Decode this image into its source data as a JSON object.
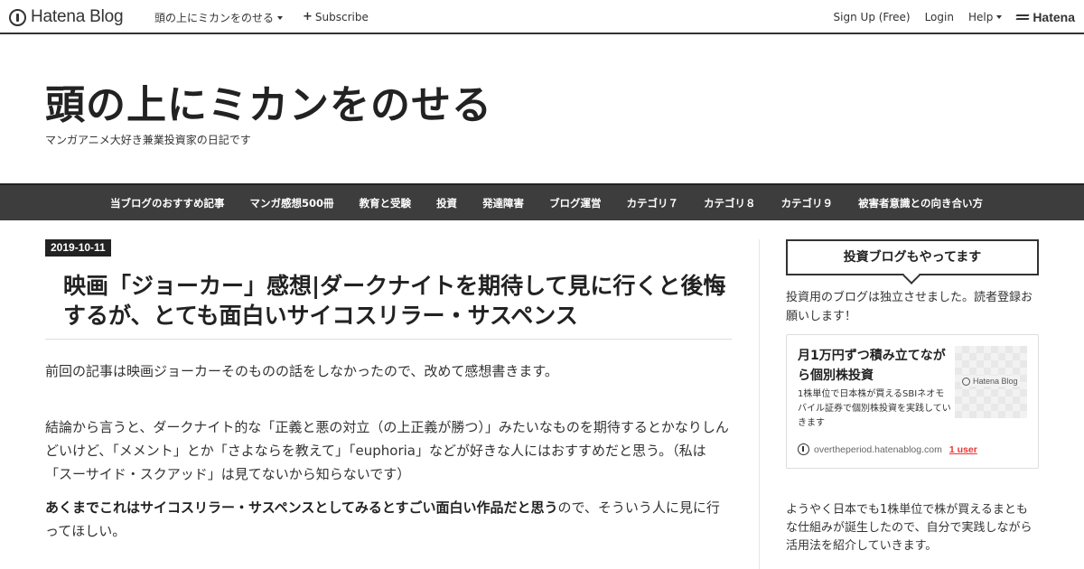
{
  "topbar": {
    "logo_text": "Hatena Blog",
    "blog_menu": "頭の上にミカンをのせる",
    "subscribe": "Subscribe",
    "signup": "Sign Up (Free)",
    "login": "Login",
    "help": "Help",
    "hatena": "Hatena"
  },
  "header": {
    "title": "頭の上にミカンをのせる",
    "description": "マンガアニメ大好き兼業投資家の日記です"
  },
  "nav": {
    "items": [
      "当ブログのおすすめ記事",
      "マンガ感想500冊",
      "教育と受験",
      "投資",
      "発達障害",
      "ブログ運営",
      "カテゴリ７",
      "カテゴリ８",
      "カテゴリ９",
      "被害者意識との向き合い方"
    ]
  },
  "entry": {
    "date": "2019-10-11",
    "title": "映画「ジョーカー」感想|ダークナイトを期待して見に行くと後悔するが、とても面白いサイコスリラー・サスペンス",
    "p1": "前回の記事は映画ジョーカーそのものの話をしなかったので、改めて感想書きます。",
    "p2": "結論から言うと、ダークナイト的な「正義と悪の対立（の上正義が勝つ）」みたいなものを期待するとかなりしんどいけど、「メメント」とか「さよならを教えて」「euphoria」などが好きな人にはおすすめだと思う。（私は「スーサイド・スクアッド」は見てないから知らないです）",
    "p3_bold": "あくまでこれはサイコスリラー・サスペンスとしてみるとすごい面白い作品だと思う",
    "p3_rest": "ので、そういう人に見に行ってほしい。"
  },
  "sidebar": {
    "heading": "投資ブログもやってます",
    "intro": "投資用のブログは独立させました。読者登録お願いします！",
    "card": {
      "title": "月1万円ずつ積み立てながら個別株投資",
      "description": "1株単位で日本株が買えるSBIネオモバイル証券で個別株投資を実践していきます",
      "thumb_label": "Hatena Blog",
      "domain": "overtheperiod.hatenablog.com",
      "users": "1 user"
    },
    "text": "ようやく日本でも1株単位で株が買えるまともな仕組みが誕生したので、自分で実践しながら活用法を紹介していきます。"
  }
}
